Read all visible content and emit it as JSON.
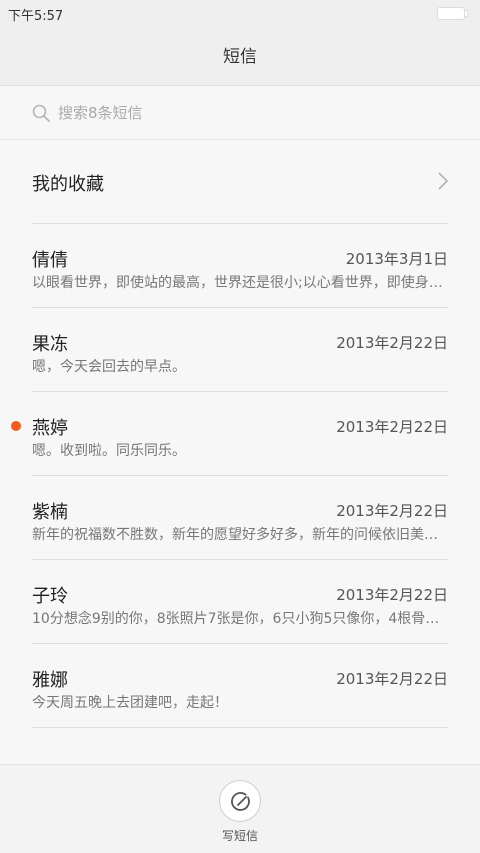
{
  "status_bar": {
    "time": "下午5:57"
  },
  "header": {
    "title": "短信"
  },
  "search": {
    "placeholder": "搜索8条短信"
  },
  "favorites": {
    "label": "我的收藏"
  },
  "messages": [
    {
      "name": "倩倩",
      "date": "2013年3月1日",
      "preview": "以眼看世界，即使站的最高，世界还是很小;以心看世界，即使身…",
      "unread": false
    },
    {
      "name": "果冻",
      "date": "2013年2月22日",
      "preview": "嗯，今天会回去的早点。",
      "unread": false
    },
    {
      "name": "燕婷",
      "date": "2013年2月22日",
      "preview": "嗯。收到啦。同乐同乐。",
      "unread": true
    },
    {
      "name": "紫楠",
      "date": "2013年2月22日",
      "preview": "新年的祝福数不胜数，新年的愿望好多好多，新年的问候依旧美…",
      "unread": false
    },
    {
      "name": "子玲",
      "date": "2013年2月22日",
      "preview": "10分想念9别的你，8张照片7张是你，6只小狗5只像你，4根骨…",
      "unread": false
    },
    {
      "name": "雅娜",
      "date": "2013年2月22日",
      "preview": "今天周五晚上去团建吧，走起！",
      "unread": false
    }
  ],
  "bottom": {
    "compose_label": "写短信"
  },
  "colors": {
    "unread_dot": "#f35a1b"
  }
}
